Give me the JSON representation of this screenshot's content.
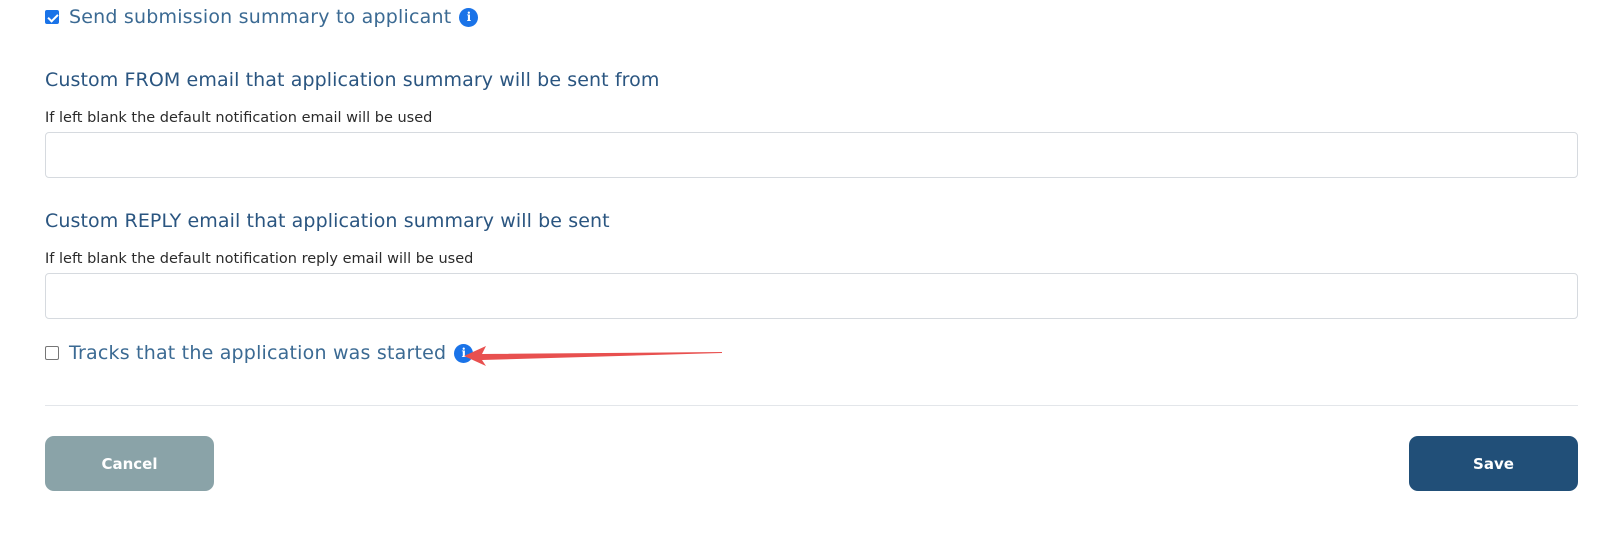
{
  "summary_checkbox": {
    "label": "Send submission summary to applicant",
    "checked": true,
    "info_icon": "info-icon"
  },
  "from_email": {
    "title": "Custom FROM email that application summary will be sent from",
    "hint": "If left blank the default notification email will be used",
    "value": "",
    "placeholder": ""
  },
  "reply_email": {
    "title": "Custom REPLY email that application summary will be sent",
    "hint": "If left blank the default notification reply email will be used",
    "value": "",
    "placeholder": ""
  },
  "tracking_checkbox": {
    "label": "Tracks that the application was started",
    "checked": false,
    "info_icon": "info-icon"
  },
  "actions": {
    "cancel_label": "Cancel",
    "save_label": "Save"
  },
  "colors": {
    "accent": "#1a73e8",
    "heading": "#2a5580",
    "cancel_button": "#8aa3a8",
    "save_button": "#214f78",
    "annotation_arrow": "#e8504f"
  }
}
